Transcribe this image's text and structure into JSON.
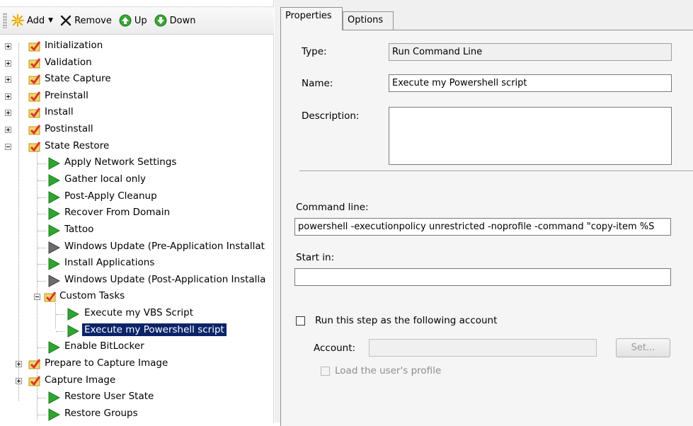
{
  "toolbar": {
    "add_label": "Add",
    "remove_label": "Remove",
    "up_label": "Up",
    "down_label": "Down"
  },
  "tree": {
    "groups": [
      {
        "label": "Initialization"
      },
      {
        "label": "Validation"
      },
      {
        "label": "State Capture"
      },
      {
        "label": "Preinstall"
      },
      {
        "label": "Install"
      },
      {
        "label": "Postinstall"
      },
      {
        "label": "State Restore"
      },
      {
        "label": "Custom Tasks"
      },
      {
        "label": "Prepare to Capture Image"
      },
      {
        "label": "Capture Image"
      }
    ],
    "steps": [
      {
        "label": "Apply Network Settings"
      },
      {
        "label": "Gather local only"
      },
      {
        "label": "Post-Apply Cleanup"
      },
      {
        "label": "Recover From Domain"
      },
      {
        "label": "Tattoo"
      },
      {
        "label": "Windows Update (Pre-Application Installat"
      },
      {
        "label": "Install Applications"
      },
      {
        "label": "Windows Update (Post-Application Installa"
      },
      {
        "label": "Execute my VBS Script"
      },
      {
        "label": "Execute my Powershell script"
      },
      {
        "label": "Enable BitLocker"
      },
      {
        "label": "Restore User State"
      },
      {
        "label": "Restore Groups"
      }
    ]
  },
  "tabs": [
    {
      "label": "Properties"
    },
    {
      "label": "Options"
    }
  ],
  "properties": {
    "type_label": "Type:",
    "type_value": "Run Command Line",
    "name_label": "Name:",
    "name_value": "Execute my Powershell script",
    "description_label": "Description:",
    "description_value": "",
    "command_line_label": "Command line:",
    "command_line_value": "powershell -executionpolicy unrestricted -noprofile -command \"copy-item %S",
    "start_in_label": "Start in:",
    "start_in_value": "",
    "run_as_label": "Run this step as the following account",
    "account_label": "Account:",
    "account_value": "",
    "set_button_label": "Set...",
    "load_profile_label": "Load the user's profile"
  },
  "colors": {
    "selection": "#0a246a",
    "panel_bg": "#f0f0f0",
    "check_icon_red": "#d9362b",
    "play_icon_green": "#2fa52f",
    "play_icon_gray": "#6c6c6c"
  }
}
